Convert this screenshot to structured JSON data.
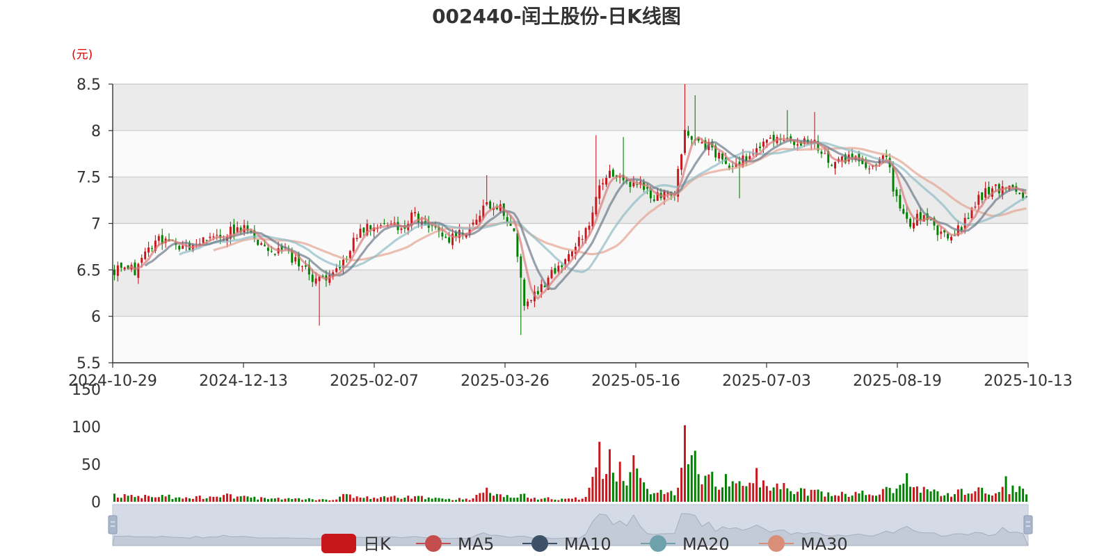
{
  "chart_data": {
    "type": "candlestick",
    "title": "002440-闰土股份-日K线图",
    "y_unit": "(元)",
    "price_axis": {
      "ticks": [
        "8.5",
        "8",
        "7.5",
        "7",
        "6.5",
        "6",
        "5.5"
      ],
      "ylim": [
        5.5,
        8.5
      ]
    },
    "volume_axis": {
      "ticks": [
        "150",
        "100",
        "50",
        "0"
      ],
      "ylim": [
        0,
        150
      ]
    },
    "x_ticks": [
      "2024-10-29",
      "2024-12-13",
      "2025-02-07",
      "2025-03-26",
      "2025-05-16",
      "2025-07-03",
      "2025-08-19",
      "2025-10-13"
    ],
    "grid": true,
    "legend_position": "bottom",
    "legend": [
      "日K",
      "MA5",
      "MA10",
      "MA20",
      "MA30"
    ],
    "colors": {
      "up": "#c8161d",
      "down": "#008000",
      "MA5": "#d97a7a",
      "MA10": "#6e7b89",
      "MA20": "#8fbcc4",
      "MA30": "#e2a591",
      "grid_band": "#ebebeb",
      "zoom_fill": "#d5dbe6"
    },
    "anchors": [
      {
        "i": 0,
        "p": 6.5,
        "v": 8
      },
      {
        "i": 6,
        "p": 6.5,
        "v": 7
      },
      {
        "i": 13,
        "p": 6.85,
        "v": 7
      },
      {
        "i": 20,
        "p": 6.75,
        "v": 6
      },
      {
        "i": 27,
        "p": 6.8,
        "v": 6
      },
      {
        "i": 34,
        "p": 6.92,
        "v": 8
      },
      {
        "i": 39,
        "p": 6.95,
        "v": 6
      },
      {
        "i": 44,
        "p": 6.7,
        "v": 5
      },
      {
        "i": 50,
        "p": 6.7,
        "v": 5
      },
      {
        "i": 54,
        "p": 6.55,
        "v": 4
      },
      {
        "i": 59,
        "p": 6.4,
        "v": 3
      },
      {
        "i": 64,
        "p": 6.42,
        "v": 2
      },
      {
        "i": 67,
        "p": 6.55,
        "v": 10
      },
      {
        "i": 72,
        "p": 6.95,
        "v": 5
      },
      {
        "i": 78,
        "p": 7.0,
        "v": 6
      },
      {
        "i": 84,
        "p": 6.95,
        "v": 6
      },
      {
        "i": 88,
        "p": 7.1,
        "v": 7
      },
      {
        "i": 92,
        "p": 6.95,
        "v": 5
      },
      {
        "i": 98,
        "p": 6.85,
        "v": 4
      },
      {
        "i": 104,
        "p": 6.95,
        "v": 4
      },
      {
        "i": 109,
        "p": 7.2,
        "v": 14
      },
      {
        "i": 113,
        "p": 7.15,
        "v": 12
      },
      {
        "i": 117,
        "p": 6.95,
        "v": 6
      },
      {
        "i": 120,
        "p": 6.1,
        "v": 8
      },
      {
        "i": 124,
        "p": 6.25,
        "v": 5
      },
      {
        "i": 129,
        "p": 6.5,
        "v": 4
      },
      {
        "i": 134,
        "p": 6.7,
        "v": 4
      },
      {
        "i": 138,
        "p": 6.9,
        "v": 5
      },
      {
        "i": 141,
        "p": 7.3,
        "v": 52
      },
      {
        "i": 144,
        "p": 7.55,
        "v": 45
      },
      {
        "i": 149,
        "p": 7.45,
        "v": 38
      },
      {
        "i": 153,
        "p": 7.45,
        "v": 32
      },
      {
        "i": 158,
        "p": 7.3,
        "v": 14
      },
      {
        "i": 164,
        "p": 7.35,
        "v": 10
      },
      {
        "i": 167,
        "p": 7.95,
        "v": 65
      },
      {
        "i": 170,
        "p": 7.9,
        "v": 40
      },
      {
        "i": 175,
        "p": 7.8,
        "v": 30
      },
      {
        "i": 180,
        "p": 7.65,
        "v": 25
      },
      {
        "i": 185,
        "p": 7.7,
        "v": 18
      },
      {
        "i": 190,
        "p": 7.85,
        "v": 20
      },
      {
        "i": 194,
        "p": 7.95,
        "v": 22
      },
      {
        "i": 199,
        "p": 7.85,
        "v": 14
      },
      {
        "i": 204,
        "p": 7.9,
        "v": 12
      },
      {
        "i": 210,
        "p": 7.65,
        "v": 10
      },
      {
        "i": 216,
        "p": 7.7,
        "v": 10
      },
      {
        "i": 222,
        "p": 7.6,
        "v": 12
      },
      {
        "i": 226,
        "p": 7.7,
        "v": 14
      },
      {
        "i": 229,
        "p": 7.25,
        "v": 22
      },
      {
        "i": 233,
        "p": 7.0,
        "v": 20
      },
      {
        "i": 237,
        "p": 7.1,
        "v": 16
      },
      {
        "i": 240,
        "p": 6.95,
        "v": 12
      },
      {
        "i": 245,
        "p": 6.85,
        "v": 12
      },
      {
        "i": 249,
        "p": 7.0,
        "v": 14
      },
      {
        "i": 253,
        "p": 7.3,
        "v": 14
      },
      {
        "i": 257,
        "p": 7.35,
        "v": 14
      },
      {
        "i": 261,
        "p": 7.4,
        "v": 18
      },
      {
        "i": 265,
        "p": 7.35,
        "v": 16
      },
      {
        "i": 267,
        "p": 7.3,
        "v": 10
      }
    ],
    "spikes": [
      {
        "i": 60,
        "low": 5.9
      },
      {
        "i": 109,
        "high": 7.52
      },
      {
        "i": 119,
        "low": 5.8
      },
      {
        "i": 141,
        "high": 7.95
      },
      {
        "i": 149,
        "high": 7.93
      },
      {
        "i": 167,
        "high": 8.5
      },
      {
        "i": 170,
        "high": 8.38
      },
      {
        "i": 183,
        "low": 7.27
      },
      {
        "i": 197,
        "high": 8.22
      },
      {
        "i": 205,
        "high": 8.2
      }
    ],
    "vol_spikes": [
      {
        "i": 142,
        "v": 80
      },
      {
        "i": 145,
        "v": 70
      },
      {
        "i": 152,
        "v": 62
      },
      {
        "i": 167,
        "v": 102
      },
      {
        "i": 168,
        "v": 50
      },
      {
        "i": 170,
        "v": 68
      },
      {
        "i": 175,
        "v": 40
      },
      {
        "i": 188,
        "v": 45
      },
      {
        "i": 232,
        "v": 38
      },
      {
        "i": 261,
        "v": 34
      }
    ],
    "seed": 20251020,
    "bar_count": 268
  }
}
